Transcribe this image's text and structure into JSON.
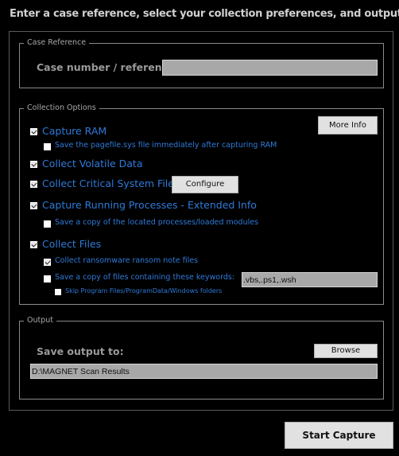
{
  "heading": "Enter a case reference, select your collection preferences, and output location:",
  "case_reference": {
    "legend": "Case Reference",
    "label": "Case number / reference:",
    "value": ""
  },
  "collection_options": {
    "legend": "Collection Options",
    "more_info_label": "More Info",
    "configure_label": "Configure",
    "capture_ram": {
      "label": "Capture RAM",
      "checked": true
    },
    "save_pagefile": {
      "label": "Save the pagefile.sys file immediately after capturing RAM",
      "checked": false
    },
    "collect_volatile": {
      "label": "Collect Volatile Data",
      "checked": true
    },
    "collect_critical": {
      "label": "Collect Critical System Files",
      "checked": true
    },
    "capture_processes": {
      "label": "Capture Running Processes - Extended Info",
      "checked": true
    },
    "save_processes": {
      "label": "Save a copy of the located processes/loaded modules",
      "checked": false
    },
    "collect_files": {
      "label": "Collect Files",
      "checked": true
    },
    "collect_ransom": {
      "label": "Collect ransomware ransom note files",
      "checked": true
    },
    "save_keywords": {
      "label": "Save a copy of files containing these keywords:",
      "checked": false,
      "value": ".vbs,.ps1,.wsh"
    },
    "skip_folders": {
      "label": "Skip Program Files/ProgramData/Windows folders",
      "checked": false
    }
  },
  "output": {
    "legend": "Output",
    "label": "Save output to:",
    "browse_label": "Browse",
    "path": "D:\\MAGNET Scan Results"
  },
  "start_capture_label": "Start Capture",
  "colors": {
    "background": "#000000",
    "option_text": "#2f7ad8",
    "button_face": "#e1e1e1",
    "field_bg": "#a8a8a8"
  }
}
